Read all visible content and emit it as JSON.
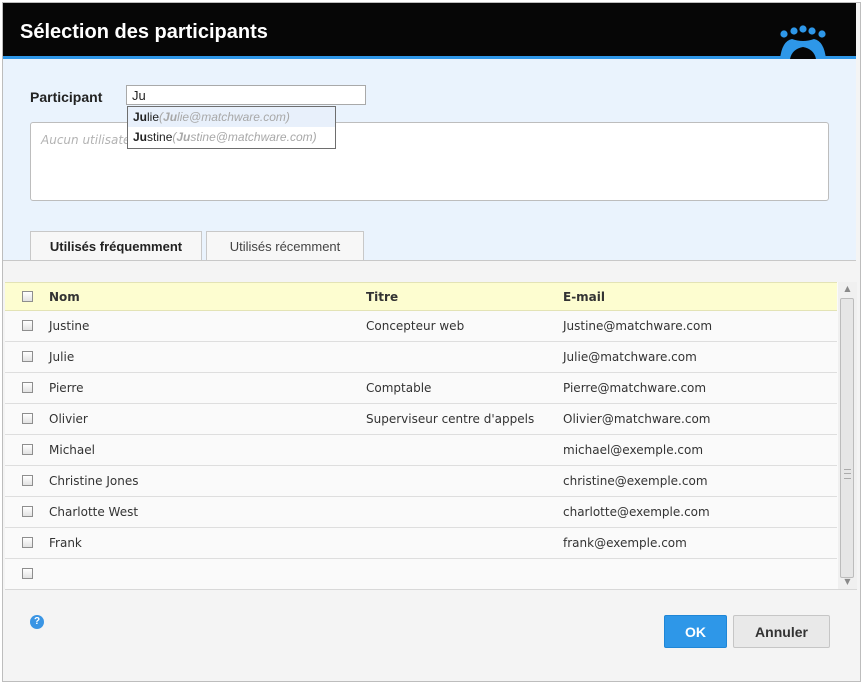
{
  "dialog": {
    "title": "Sélection des participants",
    "colors": {
      "accent": "#2e97e8",
      "titlebar": "#060606",
      "header_row": "#fdfdd0",
      "top_area": "#eaf3fd"
    }
  },
  "participant": {
    "label": "Participant",
    "input_value": "Ju",
    "empty_text": "Aucun utilisateur",
    "suggestions": [
      {
        "match": "Ju",
        "rest": "lie",
        "email_pre": "(",
        "email_match": "Ju",
        "email_rest": "lie@matchware.com)"
      },
      {
        "match": "Ju",
        "rest": "stine",
        "email_pre": "(",
        "email_match": "Ju",
        "email_rest": "stine@matchware.com)"
      }
    ]
  },
  "tabs": [
    {
      "label": "Utilisés fréquemment",
      "active": true
    },
    {
      "label": "Utilisés récemment",
      "active": false
    }
  ],
  "table": {
    "headers": {
      "nom": "Nom",
      "titre": "Titre",
      "email": "E-mail"
    },
    "rows": [
      {
        "nom": "Justine",
        "titre": "Concepteur web",
        "email": "Justine@matchware.com"
      },
      {
        "nom": "Julie",
        "titre": "",
        "email": "Julie@matchware.com"
      },
      {
        "nom": "Pierre",
        "titre": "Comptable",
        "email": "Pierre@matchware.com"
      },
      {
        "nom": "Olivier",
        "titre": "Superviseur centre d'appels",
        "email": "Olivier@matchware.com"
      },
      {
        "nom": "Michael",
        "titre": "",
        "email": "michael@exemple.com"
      },
      {
        "nom": "Christine Jones",
        "titre": "",
        "email": "christine@exemple.com"
      },
      {
        "nom": "Charlotte West",
        "titre": "",
        "email": "charlotte@exemple.com"
      },
      {
        "nom": "Frank",
        "titre": "",
        "email": "frank@exemple.com"
      },
      {
        "nom": "",
        "titre": "",
        "email": ""
      }
    ]
  },
  "footer": {
    "help_icon": "question-circle-icon",
    "help_glyph": "?",
    "ok_label": "OK",
    "cancel_label": "Annuler"
  }
}
